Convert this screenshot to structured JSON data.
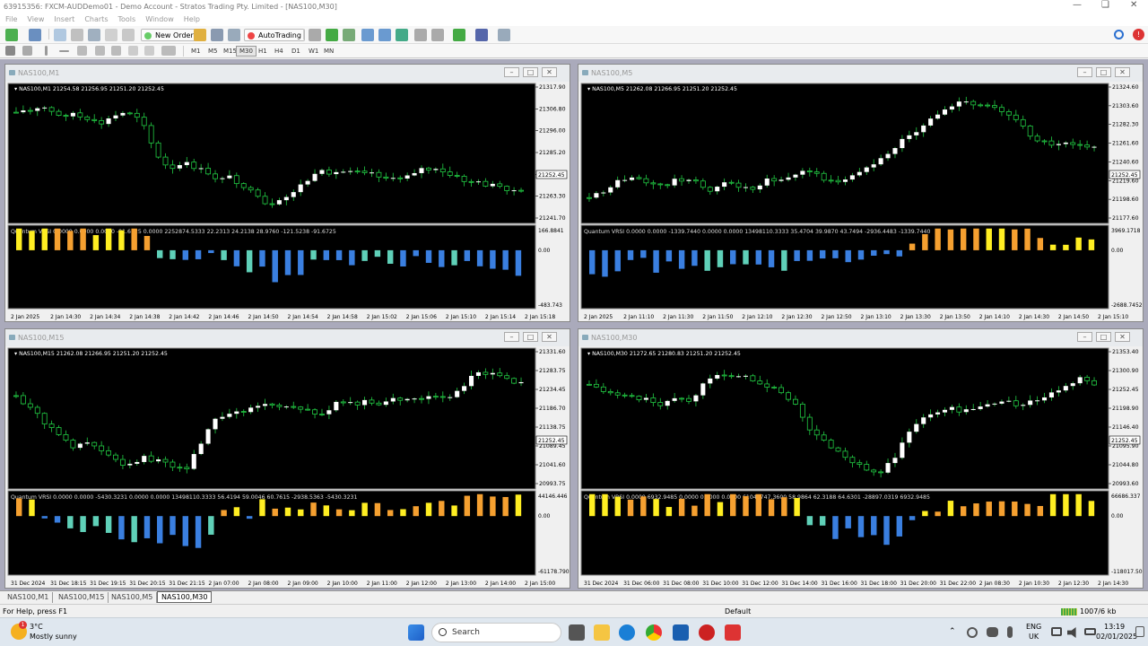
{
  "app": {
    "title": "63915356: FXCM-AUDDemo01 - Demo Account - Stratos Trading Pty. Limited - [NAS100,M30]"
  },
  "menu": [
    "File",
    "View",
    "Insert",
    "Charts",
    "Tools",
    "Window",
    "Help"
  ],
  "toolbar": {
    "new_order": "New Order",
    "autotrading": "AutoTrading",
    "timeframes": [
      "M1",
      "M5",
      "M15",
      "M30",
      "H1",
      "H4",
      "D1",
      "W1",
      "MN"
    ],
    "selected_tf": "M30"
  },
  "windows": [
    {
      "title": "NAS100,M1",
      "info": "NAS100,M1  21254.58 21256.95 21251.20 21252.45",
      "price_ticks": [
        "21317.90",
        "21306.80",
        "21296.00",
        "21285.20",
        "21274.40",
        "21263.30",
        "21241.70"
      ],
      "current_price": "21252.45",
      "ind_label": "Quantum VRSI 0.0000 0.0000 0.0000 -91.6725 0.0000 2252874.5333 22.2313 24.2138 28.9760 -121.5238 -91.6725",
      "ind_ticks": [
        "166.8841",
        "0.00",
        "-483.743"
      ],
      "time_labels": [
        "2 Jan 2025",
        "2 Jan 14:30",
        "2 Jan 14:34",
        "2 Jan 14:38",
        "2 Jan 14:42",
        "2 Jan 14:46",
        "2 Jan 14:50",
        "2 Jan 14:54",
        "2 Jan 14:58",
        "2 Jan 15:02",
        "2 Jan 15:06",
        "2 Jan 15:10",
        "2 Jan 15:14",
        "2 Jan 15:18"
      ]
    },
    {
      "title": "NAS100,M5",
      "info": "NAS100,M5  21262.08 21266.95 21251.20 21252.45",
      "price_ticks": [
        "21324.60",
        "21303.60",
        "21282.30",
        "21261.60",
        "21240.60",
        "21219.60",
        "21198.60",
        "21177.60"
      ],
      "current_price": "21252.45",
      "ind_label": "Quantum VRSI 0.0000 0.0000 -1339.7440 0.0000 0.0000 13498110.3333 35.4704 39.9870 43.7494 -2936.4483 -1339.7440",
      "ind_ticks": [
        "3969.1718",
        "0.00",
        "-2688.7452"
      ],
      "time_labels": [
        "2 Jan 2025",
        "2 Jan 11:10",
        "2 Jan 11:30",
        "2 Jan 11:50",
        "2 Jan 12:10",
        "2 Jan 12:30",
        "2 Jan 12:50",
        "2 Jan 13:10",
        "2 Jan 13:30",
        "2 Jan 13:50",
        "2 Jan 14:10",
        "2 Jan 14:30",
        "2 Jan 14:50",
        "2 Jan 15:10"
      ]
    },
    {
      "title": "NAS100,M15",
      "info": "NAS100,M15  21262.08 21266.95 21251.20 21252.45",
      "price_ticks": [
        "21331.60",
        "21283.75",
        "21234.45",
        "21186.70",
        "21138.75",
        "21089.45",
        "21041.60",
        "20993.75"
      ],
      "current_price": "21252.45",
      "ind_label": "Quantum VRSI 0.0000 0.0000 -5430.3231 0.0000 0.0000 13498110.3333 56.4194 59.0046 60.7615 -2938.5363 -5430.3231",
      "ind_ticks": [
        "44146.446",
        "0.00",
        "-61178.790"
      ],
      "time_labels": [
        "31 Dec 2024",
        "31 Dec 18:15",
        "31 Dec 19:15",
        "31 Dec 20:15",
        "31 Dec 21:15",
        "2 Jan 07:00",
        "2 Jan 08:00",
        "2 Jan 09:00",
        "2 Jan 10:00",
        "2 Jan 11:00",
        "2 Jan 12:00",
        "2 Jan 13:00",
        "2 Jan 14:00",
        "2 Jan 15:00"
      ]
    },
    {
      "title": "NAS100,M30",
      "info": "NAS100,M30  21272.65 21280.83 21251.20 21252.45",
      "price_ticks": [
        "21353.40",
        "21300.90",
        "21252.45",
        "21198.90",
        "21146.40",
        "21095.90",
        "21044.80",
        "20993.60"
      ],
      "current_price": "21252.45",
      "ind_label": "Quantum VRSI 0.0000 6932.9485 0.0000 0.0000 0.0000 61041747.3600 58.9864 62.3188 64.6301 -28897.0319 6932.9485",
      "ind_ticks": [
        "66686.337",
        "0.00",
        "-118017.50"
      ],
      "time_labels": [
        "31 Dec 2024",
        "31 Dec 06:00",
        "31 Dec 08:00",
        "31 Dec 10:00",
        "31 Dec 12:00",
        "31 Dec 14:00",
        "31 Dec 16:00",
        "31 Dec 18:00",
        "31 Dec 20:00",
        "31 Dec 22:00",
        "2 Jan 08:30",
        "2 Jan 10:30",
        "2 Jan 12:30",
        "2 Jan 14:30"
      ]
    }
  ],
  "tabs": [
    "NAS100,M1",
    "NAS100,M15",
    "NAS100,M5",
    "NAS100,M30"
  ],
  "active_tab": "NAS100,M30",
  "status": {
    "help": "For Help, press F1",
    "profile": "Default",
    "traffic": "1007/6 kb"
  },
  "taskbar": {
    "weather_temp": "3°C",
    "weather_desc": "Mostly sunny",
    "search": "Search",
    "lang1": "ENG",
    "lang2": "UK",
    "time": "13:19",
    "date": "02/01/2025"
  },
  "colors": {
    "bull": "#ffffff",
    "bear": "#ffffff",
    "wick": "#22cc44",
    "bar_yellow": "#ffee22",
    "bar_orange": "#f5a030",
    "bar_blue": "#3a7fe0",
    "bar_teal": "#5fd0b8"
  }
}
